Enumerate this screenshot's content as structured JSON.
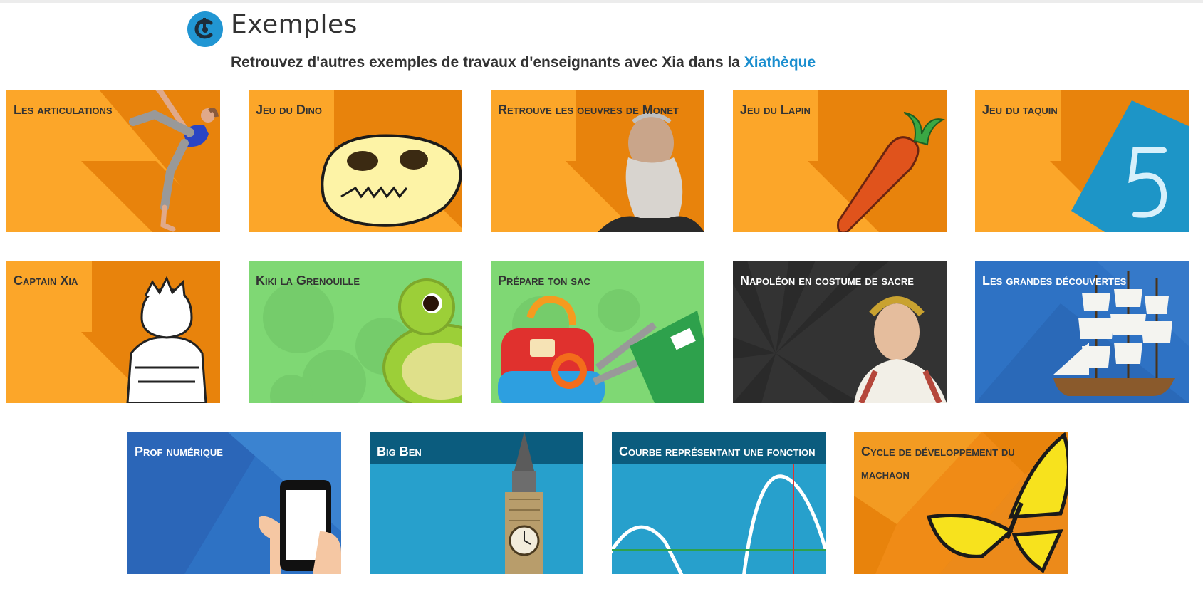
{
  "header": {
    "title": "Exemples",
    "subtitle_prefix": "Retrouvez d'autres exemples de travaux d'enseignants avec Xia dans la ",
    "subtitle_link": "Xiathèque",
    "link_color": "#1a8ecf",
    "logo_icon": "xia-logo-icon"
  },
  "cards": [
    {
      "title": "Les articulations",
      "theme": "orange",
      "image": "dancer-image"
    },
    {
      "title": "Jeu du Dino",
      "theme": "orange",
      "image": "dino-skull-image"
    },
    {
      "title": "Retrouve les oeuvres de Monet",
      "theme": "orange",
      "image": "monet-portrait-image"
    },
    {
      "title": "Jeu du Lapin",
      "theme": "orange",
      "image": "carrot-image"
    },
    {
      "title": "Jeu du taquin",
      "theme": "orange",
      "image": "number-five-tile-image"
    },
    {
      "title": "Captain Xia",
      "theme": "orange",
      "image": "captain-xia-drawing-image"
    },
    {
      "title": "Kiki la Grenouille",
      "theme": "green",
      "image": "frog-image"
    },
    {
      "title": "Prépare ton sac",
      "theme": "green",
      "image": "school-supplies-image"
    },
    {
      "title": "Napoléon en costume de sacre",
      "theme": "dark",
      "image": "napoleon-portrait-image"
    },
    {
      "title": "Les grandes découvertes",
      "theme": "blue",
      "image": "sailing-ship-image"
    },
    {
      "title": "Prof numérique",
      "theme": "blue",
      "image": "smartphone-hand-image"
    },
    {
      "title": "Big Ben",
      "theme": "teal",
      "image": "big-ben-image"
    },
    {
      "title": "Courbe représentant une fonction",
      "theme": "teal",
      "image": "function-curve-image"
    },
    {
      "title": "Cycle de développement du machaon",
      "theme": "orange-poly",
      "image": "butterfly-image"
    }
  ],
  "colors": {
    "orange_light": "#fca629",
    "orange_dark": "#e8830c",
    "green": "#7fd874",
    "dark": "#333333",
    "blue": "#2e72c4",
    "teal": "#27a0cc",
    "teal_dark": "#0b5c7e"
  }
}
